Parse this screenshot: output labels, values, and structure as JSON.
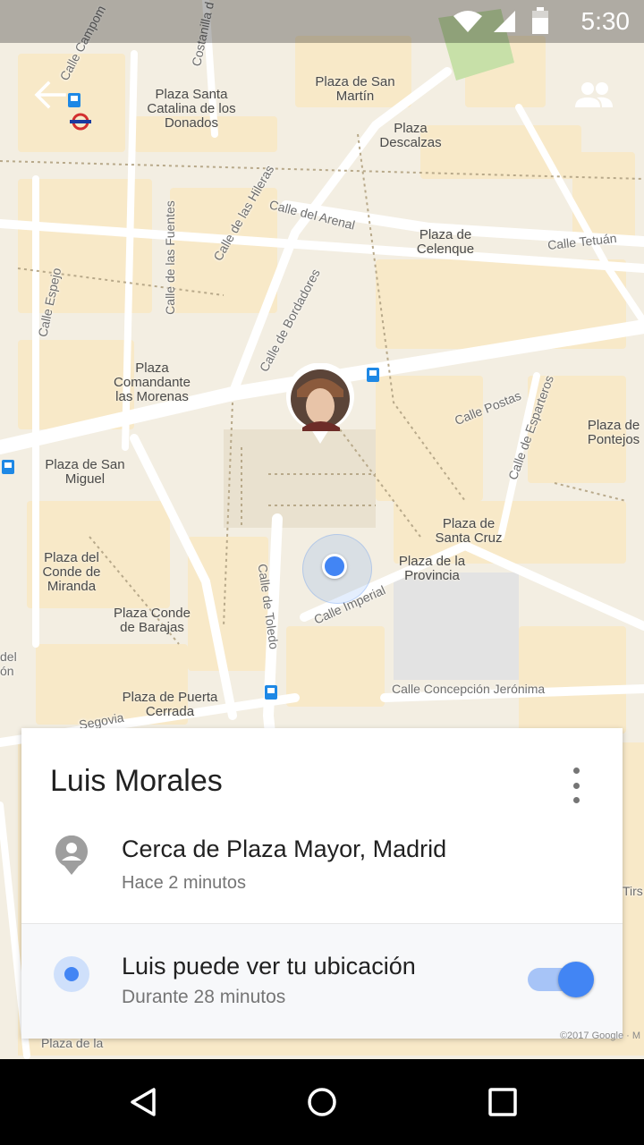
{
  "status_bar": {
    "time": "5:30"
  },
  "map": {
    "places": [
      "Plaza Santa Catalina de los Donados",
      "Plaza de San Martín",
      "Plaza Descalzas",
      "Plaza de Celenque",
      "Plaza Comandante las Morenas",
      "Plaza de San Miguel",
      "Plaza de Pontejos",
      "Plaza de Santa Cruz",
      "Plaza de la Provincia",
      "Plaza del Conde de Miranda",
      "Plaza Conde de Barajas",
      "Plaza de Puerta Cerrada"
    ],
    "streets": [
      "Calle Campom",
      "Costanilla d",
      "Calle del Arenal",
      "Calle Tetuán",
      "Calle de las Hileras",
      "Calle de las Fuentes",
      "Calle Espejo",
      "Calle de Bordadores",
      "Calle Postas",
      "Calle de Esparteros",
      "Calle Imperial",
      "Calle de Toledo",
      "Calle Concepción Jerónima",
      "Segovia",
      "del",
      "ón",
      "Tirs",
      "Plaza de la"
    ],
    "copyright": "©2017 Google · M"
  },
  "card": {
    "name": "Luis Morales",
    "location_title": "Cerca de Plaza Mayor, Madrid",
    "location_time": "Hace 2 minutos",
    "share_title": "Luis puede ver tu ubicación",
    "share_duration": "Durante 28 minutos",
    "share_enabled": true
  },
  "colors": {
    "accent": "#4285f4",
    "map_bg": "#f3eee2"
  }
}
